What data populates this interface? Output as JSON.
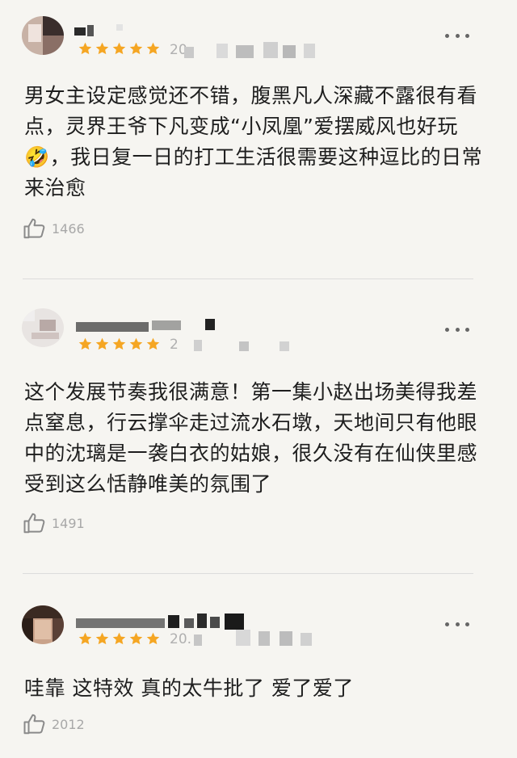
{
  "reviews": [
    {
      "username": "",
      "rating": 5,
      "date": "20",
      "text": "男女主设定感觉还不错，腹黑凡人深藏不露很有看点，灵界王爷下凡变成“小凤凰”爱摆威风也好玩🤣，我日复一日的打工生活很需要这种逗比的日常来治愈",
      "likes": "1466"
    },
    {
      "username": "",
      "rating": 5,
      "date": "2",
      "text": "这个发展节奏我很满意！第一集小赵出场美得我差点窒息，行云撑伞走过流水石墩，天地间只有他眼中的沈璃是一袭白衣的姑娘，很久没有在仙侠里感受到这么恬静唯美的氛围了",
      "likes": "1491"
    },
    {
      "username": "",
      "rating": 5,
      "date": "20.",
      "text": "哇靠 这特效 真的太牛批了 爱了爱了",
      "likes": "2012"
    }
  ],
  "colors": {
    "star": "#f5a623",
    "background": "#f6f5f1",
    "muted": "#a8a8a8"
  },
  "icons": {
    "more": "more-dots-icon",
    "like": "thumbs-up-icon",
    "star": "star-icon"
  }
}
